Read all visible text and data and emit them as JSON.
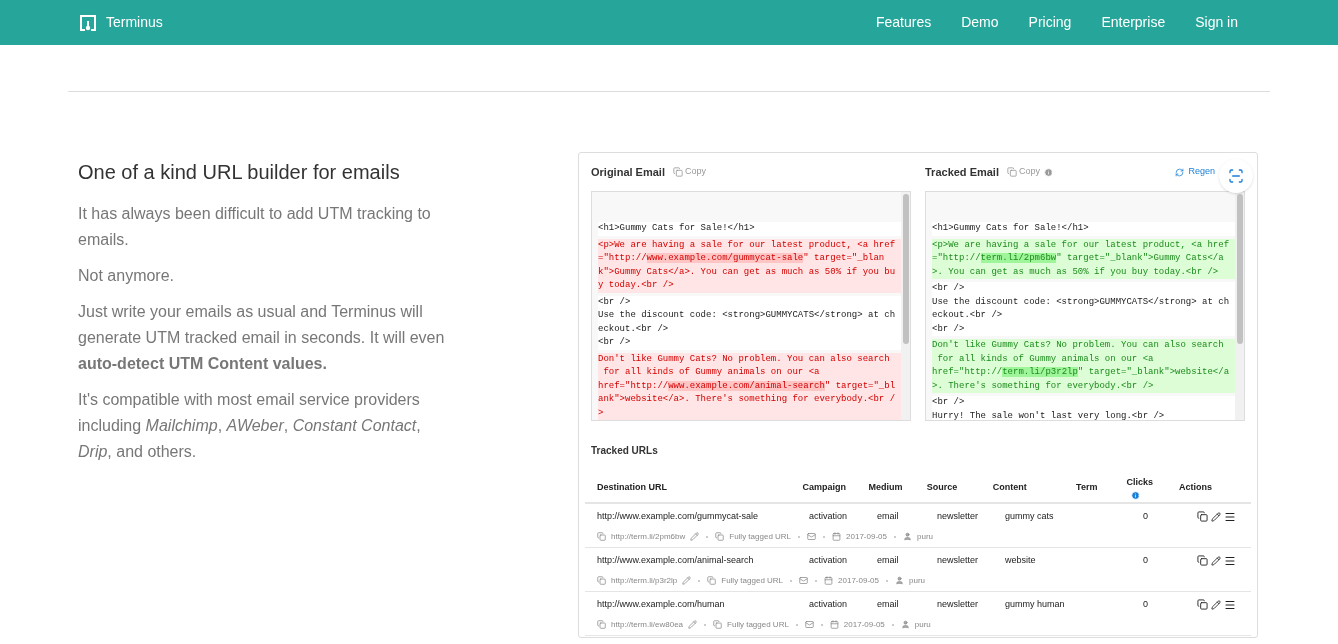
{
  "nav": {
    "brand": "Terminus",
    "links": [
      "Features",
      "Demo",
      "Pricing",
      "Enterprise",
      "Sign in"
    ]
  },
  "intro": {
    "title": "One of a kind URL builder for emails",
    "paragraphs": [
      "It has always been difficult to add UTM tracking to emails.",
      "Not anymore.",
      "Just write your emails as usual and Terminus will generate UTM tracked email in seconds. It will even **auto-detect UTM Content values.**",
      "It's compatible with most email service providers including *Mailchimp*, *AWeber*, *Constant Contact*, *Drip*, and others."
    ]
  },
  "emails": [
    {
      "title": "Original Email",
      "copy_label": "Copy",
      "info": false,
      "blocks": [
        {
          "kind": "plain",
          "lines": [
            [
              "<h1>Gummy Cats for Sale!</h1>"
            ]
          ]
        },
        {
          "kind": "removed",
          "lines": [
            [
              "<p>We are having a sale for our latest product, <a href"
            ],
            [
              "=\"http://",
              "www.example.com/gummycat-sale",
              "\" target=\"_blan"
            ],
            [
              "k\">Gummy Cats</a>. You can get as much as 50% if you bu"
            ],
            [
              "y today.<br />"
            ]
          ]
        },
        {
          "kind": "plain",
          "lines": [
            [
              "<br />"
            ],
            [
              "Use the discount code: <strong>GUMMYCATS</strong> at ch"
            ],
            [
              "eckout.<br />"
            ],
            [
              "<br />"
            ]
          ]
        },
        {
          "kind": "removed",
          "lines": [
            [
              "Don't like Gummy Cats? No problem. You can also search"
            ],
            [
              " for all kinds of Gummy animals on our <a"
            ],
            [
              "href=\"http://",
              "www.example.com/animal-search",
              "\" target=\"_bl"
            ],
            [
              "ank\">website</a>. There's something for everybody.<br /"
            ],
            [
              ">"
            ]
          ]
        }
      ]
    },
    {
      "title": "Tracked Email",
      "copy_label": "Copy",
      "info": true,
      "action": "Regen",
      "blocks": [
        {
          "kind": "plain",
          "lines": [
            [
              "<h1>Gummy Cats for Sale!</h1>"
            ]
          ]
        },
        {
          "kind": "added",
          "lines": [
            [
              "<p>We are having a sale for our latest product, <a href"
            ],
            [
              "=\"http://",
              "term.li/2pm6bw",
              "\" target=\"_blank\">Gummy Cats</a"
            ],
            [
              ">. You can get as much as 50% if you buy today.<br />"
            ]
          ]
        },
        {
          "kind": "plain",
          "lines": [
            [
              "<br />"
            ],
            [
              "Use the discount code: <strong>GUMMYCATS</strong> at ch"
            ],
            [
              "eckout.<br />"
            ],
            [
              "<br />"
            ]
          ]
        },
        {
          "kind": "added",
          "lines": [
            [
              "Don't like Gummy Cats? No problem. You can also search"
            ],
            [
              " for all kinds of Gummy animals on our <a"
            ],
            [
              "href=\"http://",
              "term.li/p3r2lp",
              "\" target=\"_blank\">website</a"
            ],
            [
              ">. There's something for everybody.<br />"
            ]
          ]
        },
        {
          "kind": "plain",
          "lines": [
            [
              "<br />"
            ],
            [
              "Hurry! The sale won't last very long.<br />"
            ]
          ]
        }
      ]
    }
  ],
  "tracked_urls": {
    "title": "Tracked URLs",
    "columns": [
      {
        "label": "Destination URL",
        "info": false
      },
      {
        "label": "Campaign",
        "info": false
      },
      {
        "label": "Medium",
        "info": false
      },
      {
        "label": "Source",
        "info": false
      },
      {
        "label": "Content",
        "info": false
      },
      {
        "label": "Term",
        "info": false
      },
      {
        "label": "Clicks",
        "info": true
      },
      {
        "label": "Actions",
        "info": false
      }
    ],
    "rows": [
      {
        "destination": "http://www.example.com/gummycat-sale",
        "campaign": "activation",
        "medium": "email",
        "source": "newsletter",
        "content": "gummy cats",
        "clicks": "0",
        "short_url": "http://term.li/2pm6bw",
        "tag_label": "Fully tagged URL",
        "date": "2017-09-05",
        "user": "puru"
      },
      {
        "destination": "http://www.example.com/animal-search",
        "campaign": "activation",
        "medium": "email",
        "source": "newsletter",
        "content": "website",
        "clicks": "0",
        "short_url": "http://term.li/p3r2lp",
        "tag_label": "Fully tagged URL",
        "date": "2017-09-05",
        "user": "puru"
      },
      {
        "destination": "http://www.example.com/human",
        "campaign": "activation",
        "medium": "email",
        "source": "newsletter",
        "content": "gummy human",
        "clicks": "0",
        "short_url": "http://term.li/ew80ea",
        "tag_label": "Fully tagged URL",
        "date": "2017-09-05",
        "user": "puru"
      }
    ]
  }
}
